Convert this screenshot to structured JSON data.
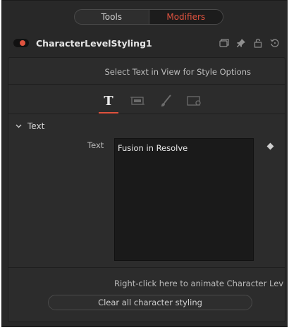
{
  "tabs": {
    "tools": "Tools",
    "modifiers": "Modifiers"
  },
  "node": {
    "title": "CharacterLevelStyling1",
    "icons": [
      "window-icon",
      "pin-icon",
      "lock-icon",
      "reset-icon"
    ],
    "accent": "#e0533f"
  },
  "panel": {
    "hint": "Select Text in View for Style Options",
    "icon_tabs": [
      "text-tab-icon",
      "layout-tab-icon",
      "shading-tab-icon",
      "transform-tab-icon"
    ],
    "text_tab_glyph": "T",
    "section_title": "Text",
    "text_label": "Text",
    "text_value": "Fusion in Resolve",
    "animate_hint": "Right-click here to animate Character Level S",
    "clear_button": "Clear all character styling"
  }
}
